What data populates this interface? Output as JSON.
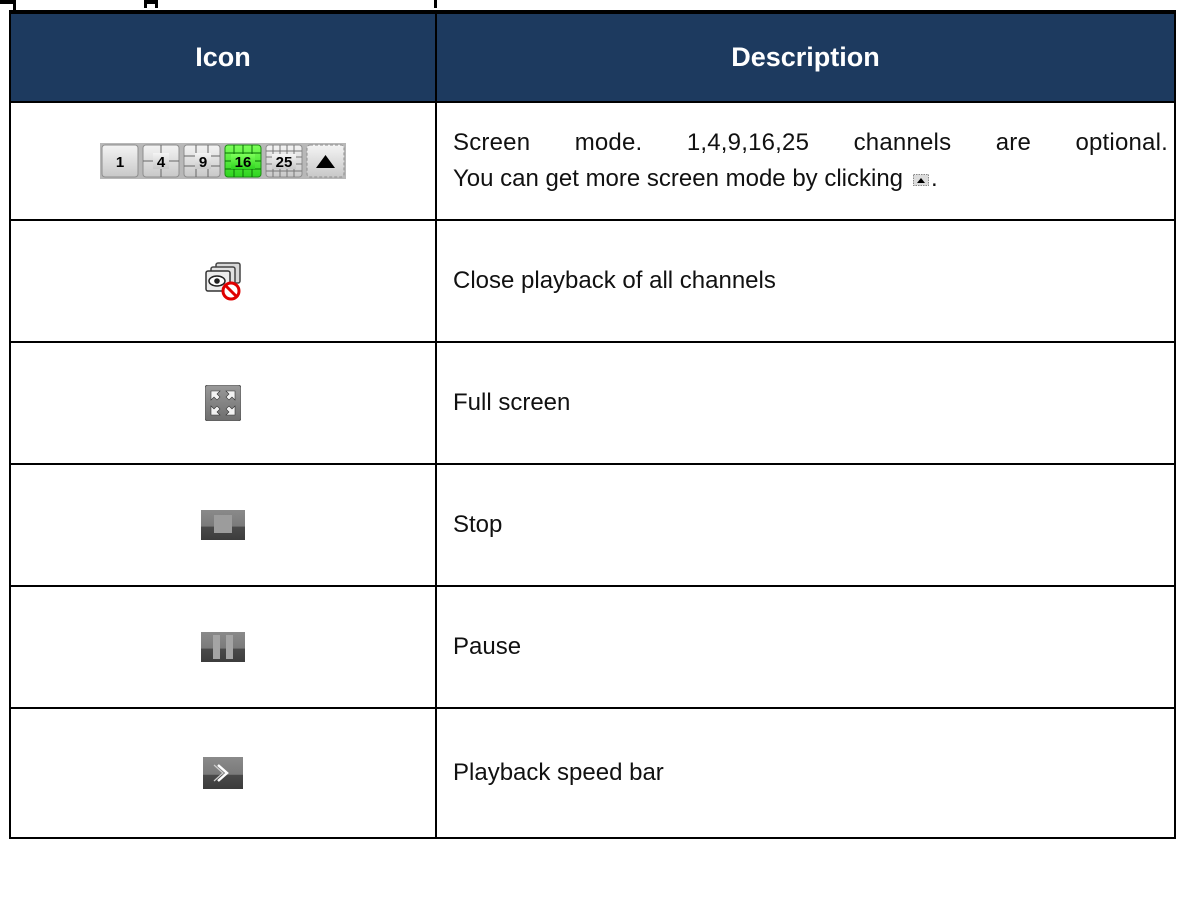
{
  "table": {
    "headers": [
      "Icon",
      "Description"
    ],
    "rows": [
      {
        "icon": "screen-mode-icons",
        "screen_mode_labels": [
          "1",
          "4",
          "9",
          "16",
          "25"
        ],
        "selected_mode": "16",
        "description_line1": "Screen mode. 1,4,9,16,25 channels are optional.",
        "description_line2_prefix": "You can get more screen mode by clicking",
        "description_line2_suffix": "."
      },
      {
        "icon": "close-playback-icon",
        "description": "Close playback of all channels"
      },
      {
        "icon": "full-screen-icon",
        "description": "Full screen"
      },
      {
        "icon": "stop-icon",
        "description": "Stop"
      },
      {
        "icon": "pause-icon",
        "description": "Pause"
      },
      {
        "icon": "playback-speed-icon",
        "description": "Playback speed bar"
      }
    ]
  },
  "colors": {
    "header_bg": "#1d3a5f",
    "header_text": "#ffffff",
    "selected_mode_bg": "#3dff2e",
    "icon_gray": "#8a8a8a"
  }
}
